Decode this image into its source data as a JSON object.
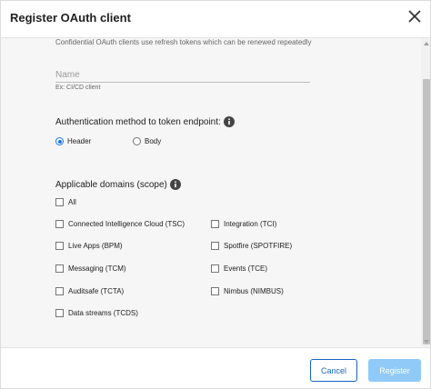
{
  "dialog": {
    "title": "Register OAuth client",
    "close_icon": "close-icon"
  },
  "form": {
    "description": "Confidential OAuth clients use refresh tokens which can be renewed repeatedly",
    "name_placeholder": "Name",
    "name_value": "",
    "name_hint": "Ex: CI/CD client",
    "auth_method": {
      "label": "Authentication method to token endpoint:",
      "info_icon": "info-icon",
      "options": [
        {
          "label": "Header",
          "selected": true
        },
        {
          "label": "Body",
          "selected": false
        }
      ]
    },
    "domains": {
      "label": "Applicable domains (scope)",
      "info_icon": "info-icon",
      "all_label": "All",
      "items": [
        {
          "label": "Connected Intelligence Cloud (TSC)",
          "checked": false
        },
        {
          "label": "Integration (TCI)",
          "checked": false
        },
        {
          "label": "Live Apps (BPM)",
          "checked": false
        },
        {
          "label": "Spotfire (SPOTFIRE)",
          "checked": false
        },
        {
          "label": "Messaging (TCM)",
          "checked": false
        },
        {
          "label": "Events (TCE)",
          "checked": false
        },
        {
          "label": "Auditsafe (TCTA)",
          "checked": false
        },
        {
          "label": "Nimbus (NIMBUS)",
          "checked": false
        },
        {
          "label": "Data streams (TCDS)",
          "checked": false
        }
      ]
    }
  },
  "footer": {
    "cancel_label": "Cancel",
    "register_label": "Register"
  },
  "colors": {
    "accent": "#1565c0",
    "register_disabled": "#90caf9",
    "content_bg": "#f6f6f6"
  }
}
